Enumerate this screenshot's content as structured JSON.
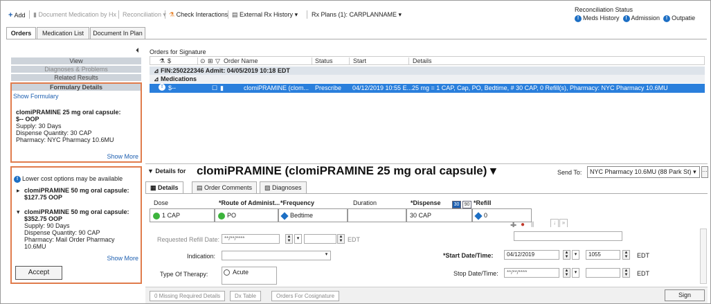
{
  "toolbar": {
    "add": "Add",
    "document_medication": "Document Medication by Hx",
    "reconciliation": "Reconciliation",
    "check_interactions": "Check Interactions",
    "external_rx": "External Rx History",
    "rx_plans": "Rx Plans (1): CARPLANNAME",
    "recon_status_title": "Reconciliation Status",
    "recon_items": [
      "Meds History",
      "Admission",
      "Outpatie"
    ]
  },
  "tabs": [
    "Orders",
    "Medication List",
    "Document In Plan"
  ],
  "left": {
    "view": "View",
    "diagnoses": "Diagnoses & Problems",
    "related": "Related Results",
    "formulary": "Formulary Details",
    "show_formulary": "Show Formulary",
    "current": {
      "name": "clomiPRAMINE 25 mg oral capsule:",
      "cost": "$-- OOP",
      "supply": "Supply: 30 Days",
      "dispense": "Dispense Quantity: 30 CAP",
      "pharmacy": "Pharmacy: NYC Pharmacy 10.6MU",
      "show_more": "Show More"
    },
    "lower_cost": "Lower cost options may be available",
    "opt1": {
      "name": "clomiPRAMINE 50 mg oral capsule:",
      "cost": "$127.75 OOP"
    },
    "opt2": {
      "name": "clomiPRAMINE 50 mg oral capsule:",
      "cost": "$352.75 OOP",
      "supply": "Supply: 90 Days",
      "dispense": "Dispense Quantity: 90 CAP",
      "pharmacy": "Pharmacy: Mail Order Pharmacy",
      "pharmacy2": "10.6MU",
      "show_more": "Show More"
    },
    "accept": "Accept"
  },
  "orders": {
    "label": "Orders for Signature",
    "headers": [
      "$",
      "Order Name",
      "Status",
      "Start",
      "Details"
    ],
    "fin_row": "FIN:250222346  Admit: 04/05/2019 10:18 EDT",
    "meds_row": "Medications",
    "selected": {
      "cost": "$--",
      "name": "clomiPRAMINE (clom...",
      "status": "Prescribe",
      "start": "04/12/2019 10:55 E...",
      "details": "25 mg = 1 CAP, Cap, PO, Bedtime, # 30 CAP, 0 Refill(s), Pharmacy: NYC Pharmacy 10.6MU"
    }
  },
  "details": {
    "for": "Details for",
    "title": "clomiPRAMINE (clomiPRAMINE 25 mg oral capsule)",
    "send_to_label": "Send To:",
    "send_to_value": "NYC Pharmacy 10.6MU (88 Park St)",
    "tabs": [
      "Details",
      "Order Comments",
      "Diagnoses"
    ],
    "cols": {
      "dose": "Dose",
      "route": "*Route of Administ...",
      "frequency": "*Frequency",
      "duration": "Duration",
      "dispense": "*Dispense",
      "d30": "30",
      "d90": "90",
      "refill": "*Refill"
    },
    "values": {
      "dose": "1 CAP",
      "route": "PO",
      "frequency": "Bedtime",
      "duration": "",
      "dispense": "30 CAP",
      "refill": "0"
    },
    "form": {
      "requested_refill": "Requested Refill Date:",
      "date_placeholder": "**/**/****",
      "edt": "EDT",
      "indication": "Indication:",
      "type_of_therapy": "Type Of Therapy:",
      "acute": "Acute",
      "start_dt": "*Start Date/Time:",
      "start_date": "04/12/2019",
      "start_time": "1055",
      "stop_dt": "Stop Date/Time:"
    }
  },
  "bottom": {
    "missing": "0 Missing Required Details",
    "dx_table": "Dx Table",
    "cosign": "Orders For Cosignature",
    "sign": "Sign"
  },
  "colors": {
    "accent": "#2a7fdc",
    "highlight_box": "#e07b4b",
    "link": "#1d5fb0"
  }
}
